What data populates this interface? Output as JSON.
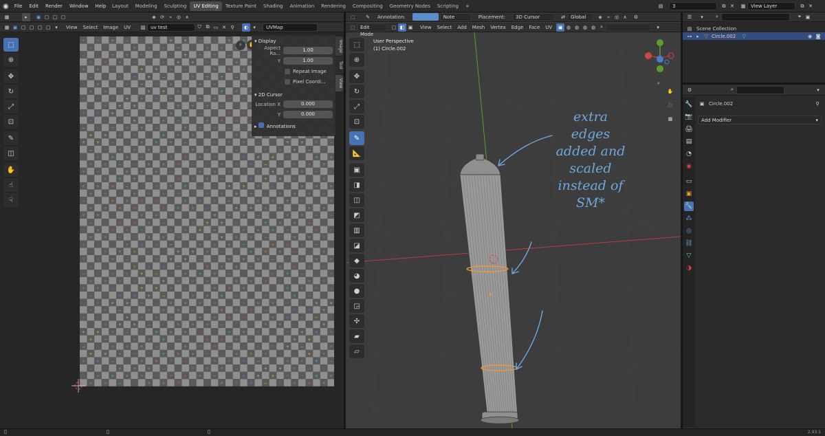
{
  "topbar": {
    "menus": [
      "File",
      "Edit",
      "Render",
      "Window",
      "Help"
    ],
    "workspaces": [
      "Layout",
      "Modeling",
      "Sculpting",
      "UV Editing",
      "Texture Paint",
      "Shading",
      "Animation",
      "Rendering",
      "Compositing",
      "Geometry Nodes",
      "Scripting"
    ],
    "active_workspace": "UV Editing",
    "scene_value": "3",
    "view_layer": "View Layer"
  },
  "uv_editor": {
    "menus": [
      "View",
      "Select",
      "Image",
      "UV"
    ],
    "image_name": "uv test",
    "uv_map": "UVMap",
    "sidebar": {
      "display_title": "Display",
      "aspect_label": "Aspect Ra...",
      "aspect_x": "1.00",
      "aspect_y_label": "Y",
      "aspect_y": "1.00",
      "repeat_image": "Repeat Image",
      "pixel_coords": "Pixel Coordi...",
      "cursor_title": "2D Cursor",
      "location_x_label": "Location X",
      "location_x": "0.000",
      "location_y_label": "Y",
      "location_y": "0.000",
      "annotations": "Annotations"
    },
    "tabs": [
      "Image",
      "Tool",
      "View"
    ]
  },
  "viewport": {
    "tool_header": {
      "annotation_label": "Annotation:",
      "note": "Note",
      "placement_label": "Placement:",
      "placement": "3D Cursor",
      "orientation": "Global"
    },
    "mode": "Edit Mode",
    "menus": [
      "View",
      "Select",
      "Add",
      "Mesh",
      "Vertex",
      "Edge",
      "Face",
      "UV"
    ],
    "overlay_line1": "User Perspective",
    "overlay_line2": "(1) Circle.002"
  },
  "annotation_note": [
    "extra",
    "edges",
    "added and",
    "scaled",
    "instead of",
    "SM*"
  ],
  "outliner": {
    "scene_collection": "Scene Collection",
    "object": "Circle.002"
  },
  "properties": {
    "object": "Circle.002",
    "add_modifier": "Add Modifier"
  },
  "status": {
    "version": "2.93.1"
  },
  "colors": {
    "accent": "#4772b3",
    "annotation": "#6fa8dc",
    "axis_red": "#b84040",
    "axis_green": "#5e9d2a"
  }
}
